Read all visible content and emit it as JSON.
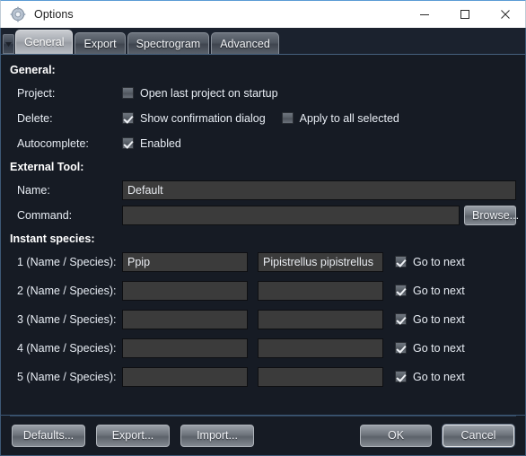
{
  "window": {
    "title": "Options",
    "icon": "gear-icon",
    "controls": {
      "minimize": "minimize-icon",
      "maximize": "maximize-icon",
      "close": "close-icon"
    }
  },
  "tabs": {
    "scroller_icon": "tab-scroll-icon",
    "items": [
      {
        "label": "General",
        "active": true
      },
      {
        "label": "Export",
        "active": false
      },
      {
        "label": "Spectrogram",
        "active": false
      },
      {
        "label": "Advanced",
        "active": false
      }
    ]
  },
  "general": {
    "heading": "General:",
    "project": {
      "label": "Project:",
      "open_last_project": {
        "label": "Open last project on startup",
        "checked": false
      }
    },
    "delete": {
      "label": "Delete:",
      "show_confirmation": {
        "label": "Show confirmation dialog",
        "checked": true
      },
      "apply_to_all": {
        "label": "Apply to all selected",
        "checked": false
      }
    },
    "autocomplete": {
      "label": "Autocomplete:",
      "enabled": {
        "label": "Enabled",
        "checked": true
      }
    }
  },
  "external_tool": {
    "heading": "External Tool:",
    "name": {
      "label": "Name:",
      "value": "Default",
      "placeholder": ""
    },
    "command": {
      "label": "Command:",
      "value": "",
      "placeholder": ""
    },
    "browse_label": "Browse..."
  },
  "instant_species": {
    "heading": "Instant species:",
    "goto_next_label": "Go to next",
    "rows": [
      {
        "label": "1 (Name / Species):",
        "name": "Ppip",
        "species": "Pipistrellus pipistrellus",
        "goto_next": true
      },
      {
        "label": "2 (Name / Species):",
        "name": "",
        "species": "",
        "goto_next": true
      },
      {
        "label": "3 (Name / Species):",
        "name": "",
        "species": "",
        "goto_next": true
      },
      {
        "label": "4 (Name / Species):",
        "name": "",
        "species": "",
        "goto_next": true
      },
      {
        "label": "5 (Name / Species):",
        "name": "",
        "species": "",
        "goto_next": true
      }
    ]
  },
  "footer": {
    "defaults_label": "Defaults...",
    "export_label": "Export...",
    "import_label": "Import...",
    "ok_label": "OK",
    "cancel_label": "Cancel"
  },
  "colors": {
    "dialog_bg": "#161b24",
    "panel_border": "#3d5876",
    "input_bg": "#3b3b3b",
    "text": "#e8edf4",
    "titlebar_bg": "#ffffff",
    "accent": "#5b9bd5"
  }
}
